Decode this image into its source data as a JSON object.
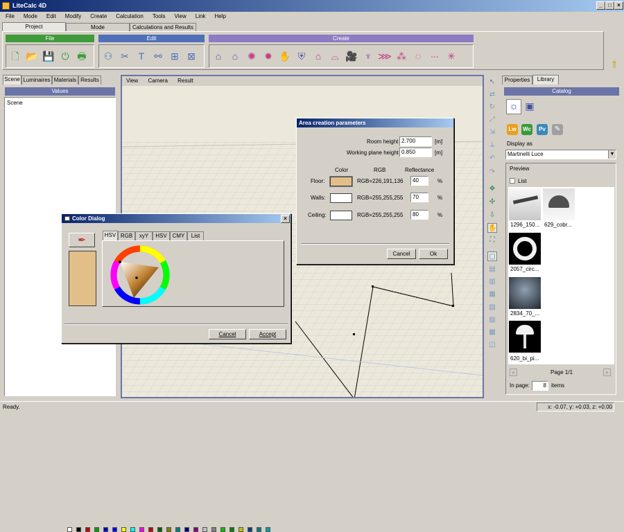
{
  "app": {
    "title": "LiteCalc 4D"
  },
  "menu": [
    "File",
    "Mode",
    "Edit",
    "Modify",
    "Create",
    "Calculation",
    "Tools",
    "View",
    "Link",
    "Help"
  ],
  "ribbon_tabs": [
    "Project",
    "Mode",
    "Calculations and Results"
  ],
  "groups": {
    "file": "File",
    "edit": "Edit",
    "create": "Create"
  },
  "left_tabs": [
    "Scene",
    "Luminaires",
    "Materials",
    "Results"
  ],
  "values_header": "Values",
  "tree_item": "Scene",
  "viewport_menu": [
    "View",
    "Camera",
    "Result"
  ],
  "area_dialog": {
    "title": "Area creation parameters",
    "room_height_label": "Room height",
    "room_height": "2.700",
    "working_plane_label": "Working plane height",
    "working_plane": "0.850",
    "unit": "[m]",
    "col_color": "Color",
    "col_rgb": "RGB",
    "col_reflectance": "Reflectance",
    "rows": [
      {
        "label": "Floor:",
        "rgb": "RGB=226,191,136",
        "refl": "40",
        "pct": "%",
        "color": "#e2bf88"
      },
      {
        "label": "Walls:",
        "rgb": "RGB=255,255,255",
        "refl": "70",
        "pct": "%",
        "color": "#ffffff"
      },
      {
        "label": "Ceiling:",
        "rgb": "RGB=255,255,255",
        "refl": "80",
        "pct": "%",
        "color": "#ffffff"
      }
    ],
    "cancel": "Cancel",
    "ok": "Ok"
  },
  "color_dialog": {
    "title": "Color Dialog",
    "tabs": [
      "HSV",
      "RGB",
      "xyY",
      "HSV",
      "CMY",
      "List"
    ],
    "current_color": "#e2bf88",
    "cancel": "Cancel",
    "accept": "Accept",
    "palette": [
      "#ffffff",
      "#000000",
      "#c00000",
      "#00a000",
      "#0000c0",
      "#0000ff",
      "#ffff00",
      "#00ffff",
      "#ff00ff",
      "#c00000",
      "#006000",
      "#808000",
      "#008080",
      "#000080",
      "#800080",
      "#c0c0c0",
      "#808080",
      "#00c000",
      "#008000",
      "#c0c000",
      "#004080",
      "#008080",
      "#00a0a0"
    ]
  },
  "right_tabs": [
    "Properties",
    "Library"
  ],
  "catalog_header": "Catalog",
  "display_as_label": "Display as",
  "display_as_value": "Martinelli Luce",
  "preview_label": "Preview",
  "list_label": "List",
  "thumbs": [
    {
      "label": "1296_150..."
    },
    {
      "label": "629_cobr..."
    },
    {
      "label": "2057_circ..."
    },
    {
      "label": "2834_70_..."
    },
    {
      "label": "620_bi_pi..."
    }
  ],
  "page_label": "Page 1/1",
  "in_page_label": "In page:",
  "in_page_value": "8",
  "items_label": "items",
  "status": {
    "left": "Ready.",
    "coords": "x: -0.07, y: +0.03, z: +0.00"
  },
  "colors": {
    "title": "#0a246a",
    "file_group": "#3f9a3a",
    "edit_group": "#4f70b8",
    "create_group": "#8e7bc4",
    "panel_header": "#6b74a6"
  }
}
